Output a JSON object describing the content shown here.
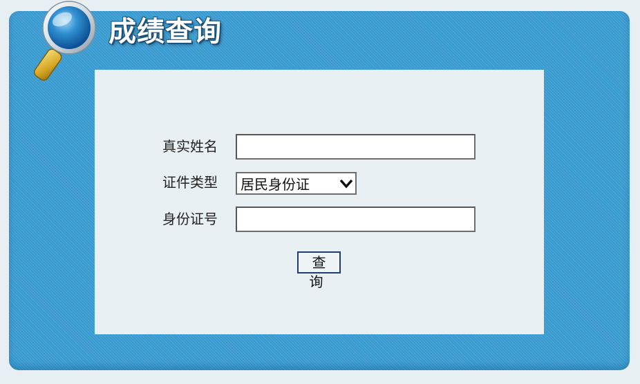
{
  "header": {
    "title": "成绩查询",
    "icon": "magnifier-icon"
  },
  "form": {
    "name_label": "真实姓名",
    "name_value": "",
    "id_type_label": "证件类型",
    "id_type_selected": "居民身份证",
    "id_number_label": "身份证号",
    "id_number_value": "",
    "submit_label": "查询"
  },
  "colors": {
    "panel_blue": "#3a9bd0",
    "content_bg": "#e9f0f3",
    "button_border": "#1d3d6e"
  }
}
